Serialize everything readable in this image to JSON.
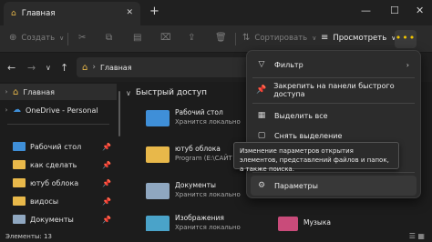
{
  "tab": {
    "title": "Главная"
  },
  "toolbar": {
    "create": "Создать",
    "sort": "Сортировать",
    "view": "Просмотреть",
    "more": "•••"
  },
  "address": {
    "location": "Главная"
  },
  "sidebar": {
    "items": [
      {
        "label": "Главная",
        "icon": "home-icon"
      },
      {
        "label": "OneDrive - Personal",
        "icon": "cloud-icon"
      },
      {
        "label": "Рабочий стол",
        "icon": "desktop-icon"
      },
      {
        "label": "как сделать",
        "icon": "folder-icon"
      },
      {
        "label": "ютуб облока",
        "icon": "folder-icon"
      },
      {
        "label": "видосы",
        "icon": "folder-icon"
      },
      {
        "label": "Документы",
        "icon": "documents-icon"
      }
    ]
  },
  "main": {
    "section_title": "Быстрый доступ",
    "items": [
      {
        "name": "Рабочий стол",
        "sub": "Хранится локально",
        "icon": "desktop-icon"
      },
      {
        "name": "ютуб облока",
        "sub": "Program (E:\\САЙТ",
        "icon": "folder-icon"
      },
      {
        "name": "Документы",
        "sub": "Хранится локально",
        "icon": "documents-icon"
      },
      {
        "name": "Изображения",
        "sub": "Хранится локально",
        "icon": "pictures-icon"
      }
    ],
    "music_label": "Музыка"
  },
  "status": {
    "elements": "Элементы: 13"
  },
  "menu": {
    "items": [
      {
        "label": "Фильтр",
        "icon": "filter-icon"
      },
      {
        "label": "Закрепить на панели быстрого доступа",
        "icon": "pin-icon"
      },
      {
        "label": "Выделить все",
        "icon": "select-all-icon"
      },
      {
        "label": "Снять выделение",
        "icon": "deselect-icon"
      },
      {
        "label": "Параметры",
        "icon": "settings-icon"
      }
    ]
  },
  "tooltip": {
    "text": "Изменение параметров открытия элементов, представлений файлов и папок, а также поиска."
  },
  "colors": {
    "accent": "#f0c400",
    "folder": "#e8b84a",
    "music": "#c94b7a",
    "desktop": "#3f8fd8"
  }
}
